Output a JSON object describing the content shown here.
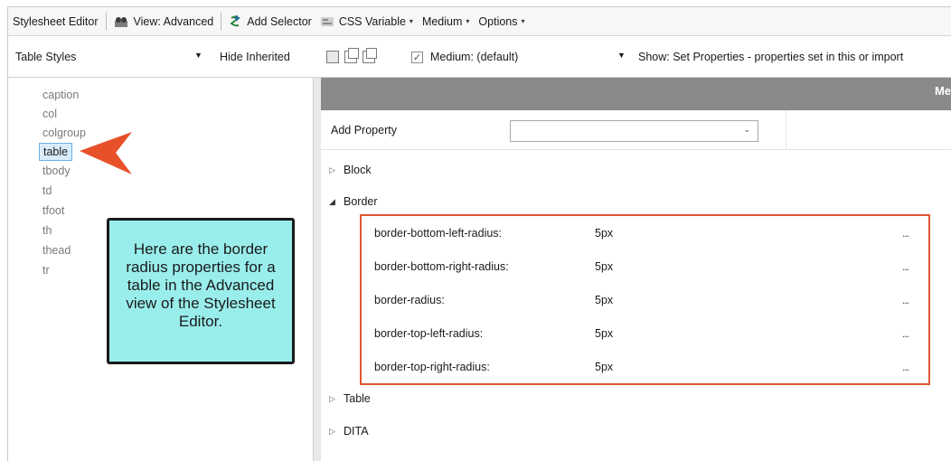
{
  "toolbar": {
    "title": "Stylesheet Editor",
    "view_label": "View: Advanced",
    "add_selector": "Add Selector",
    "css_variable": "CSS Variable",
    "medium": "Medium",
    "options": "Options"
  },
  "toolbar2": {
    "styles_dropdown": "Table Styles",
    "hide_inherited": "Hide Inherited",
    "medium_checkbox": "Medium: (default)",
    "show_filter": "Show: Set Properties - properties set in this or import"
  },
  "selectors": [
    "caption",
    "col",
    "colgroup",
    "table",
    "tbody",
    "td",
    "tfoot",
    "th",
    "thead",
    "tr"
  ],
  "selected_selector": "table",
  "callout": {
    "text": "Here are the border radius properties for a table in the Advanced view of the Stylesheet Editor."
  },
  "right": {
    "header_text": "Me",
    "add_property_label": "Add Property",
    "add_property_value": "",
    "groups": {
      "block": "Block",
      "border": "Border",
      "table": "Table",
      "dita": "DITA"
    },
    "border_properties": [
      {
        "name": "border-bottom-left-radius:",
        "value": "5px",
        "more": "..."
      },
      {
        "name": "border-bottom-right-radius:",
        "value": "5px",
        "more": "..."
      },
      {
        "name": "border-radius:",
        "value": "5px",
        "more": "..."
      },
      {
        "name": "border-top-left-radius:",
        "value": "5px",
        "more": "..."
      },
      {
        "name": "border-top-right-radius:",
        "value": "5px",
        "more": "..."
      }
    ]
  },
  "colors": {
    "callout_bg": "#99eeec",
    "highlight_border": "#e05530",
    "arrow": "#e8502a",
    "selection_bg": "#d9ecfb",
    "header_gray": "#8a8a8a"
  }
}
